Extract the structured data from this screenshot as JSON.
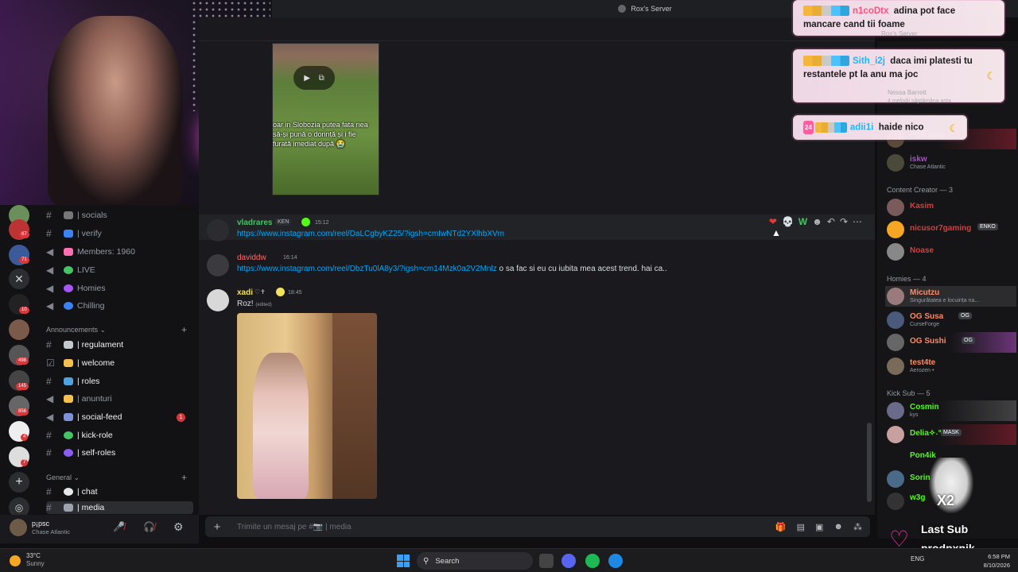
{
  "titlebar": {
    "server_title": "Rox's Server"
  },
  "webcam": {
    "label": "streamer-webcam"
  },
  "sidebar": {
    "channels_top": [
      {
        "label": "socials",
        "prefix": "|"
      },
      {
        "label": "verify",
        "prefix": "|"
      },
      {
        "label": "Members: 1960",
        "prefix": ""
      },
      {
        "label": "LIVE",
        "prefix": ""
      },
      {
        "label": "Homies",
        "prefix": ""
      },
      {
        "label": "Chilling",
        "prefix": ""
      }
    ],
    "category_announcements": "Announcements",
    "announcements": [
      {
        "label": "| regulament"
      },
      {
        "label": "| welcome"
      },
      {
        "label": "| roles"
      },
      {
        "label": "| anunturi"
      },
      {
        "label": "| social-feed",
        "notif": "1"
      },
      {
        "label": "| kick-role"
      },
      {
        "label": "| self-roles"
      }
    ],
    "category_general": "General",
    "general": [
      {
        "label": "| chat"
      },
      {
        "label": "| media"
      }
    ],
    "server_badges": [
      "67",
      "71",
      "10",
      "498",
      "145",
      "856",
      "4",
      "7"
    ]
  },
  "user_panel": {
    "name": "p¡psc",
    "status": "Chase Atlantic"
  },
  "chat": {
    "embed_caption": "oar in Slobozia putea fata nea să-și pună o dorință și i fie furată imediat după 😭",
    "messages": [
      {
        "user": "vladrares",
        "tag": "KEN",
        "time": "15:12",
        "text": "",
        "link": "https://www.instagram.com/reel/DaLCgbyKZ25/?igsh=cmIwNTd2YXlhbXVm",
        "user_color": "#43c566"
      },
      {
        "user": "daviddw",
        "tag": "",
        "time": "16:14",
        "text": " o sa fac si eu cu iubita mea acest trend. hai ca..",
        "link": "https://www.instagram.com/reel/DbzTu0lA8y3/?igsh=cm14Mzk0a2V2Mnlz",
        "user_color": "#ff6b6b"
      },
      {
        "user": "xadi",
        "tag": "",
        "time": "18:45",
        "text": "Roz!",
        "edited": "(edited)",
        "link": "",
        "user_color": "#f2e35b"
      }
    ],
    "actions": [
      "❤",
      "💀",
      "W"
    ]
  },
  "composer": {
    "placeholder": "Trimite un mesaj pe #📷 | media"
  },
  "members": {
    "top": [
      {
        "name": "iskw",
        "status": "Chase Atlantic",
        "color": "#9b59b6"
      }
    ],
    "content_creator_label": "Content Creator — 3",
    "content_creators": [
      {
        "name": "Kasim",
        "color": "#e03a3a",
        "tag": ""
      },
      {
        "name": "nicusor7gaming",
        "color": "#e03a3a",
        "tag": "ENKO"
      },
      {
        "name": "Noase",
        "color": "#e03a3a",
        "tag": ""
      }
    ],
    "homies_label": "Homies — 4",
    "homies": [
      {
        "name": "Micutzu",
        "status": "Singurătatea e locuința na...",
        "color": "#ff8a65",
        "tag": ""
      },
      {
        "name": "OG Susa",
        "status": "CurseForge",
        "color": "#ff8a65",
        "tag": "OG"
      },
      {
        "name": "OG Sushi",
        "status": "",
        "color": "#ff8a65",
        "tag": "OG"
      },
      {
        "name": "test4te",
        "status": "Aerozen •",
        "color": "#ff8a65",
        "tag": ""
      }
    ],
    "kick_sub_label": "Kick Sub — 5",
    "kick_sub": [
      {
        "name": "Cosmin",
        "status": "kys",
        "color": "#53fc18",
        "tag": ""
      },
      {
        "name": "Delia✧˖°",
        "status": "",
        "color": "#53fc18",
        "tag": "MASK"
      },
      {
        "name": "Pon4ik",
        "status": "",
        "color": "#53fc18",
        "tag": ""
      },
      {
        "name": "Sorin",
        "status": "",
        "color": "#53fc18",
        "tag": ""
      },
      {
        "name": "w3g",
        "status": "",
        "color": "#53fc18",
        "tag": ""
      }
    ]
  },
  "overlay": {
    "chat_bubbles": [
      {
        "user": "n1coDtx",
        "text": "adina pot face mancare cand tii foame",
        "name_style": "pink"
      },
      {
        "user": "Sith_i2j",
        "text": "daca imi platesti tu restantele pt la anu ma joc",
        "name_style": "blue"
      },
      {
        "user": "adii1i",
        "text": "haide nico",
        "name_style": "blue",
        "badge": "24"
      }
    ],
    "ghost_texts": [
      "Rox's Server",
      "Nessa Barrett",
      "4 melodii săptămâna asta"
    ],
    "sub_alert": {
      "title": "Last Sub",
      "name": "prodpxnik",
      "multiplier": "X2"
    }
  },
  "taskbar": {
    "weather_temp": "33°C",
    "weather_desc": "Sunny",
    "search_label": "Search",
    "lang": "ENG",
    "time": "6:58 PM",
    "date": "8/10/2026"
  },
  "colors": {
    "link": "#00a8fc",
    "accent_pink": "#ff2fa4",
    "discord_bg": "#1a1a1e",
    "notif_red": "#da373c"
  }
}
